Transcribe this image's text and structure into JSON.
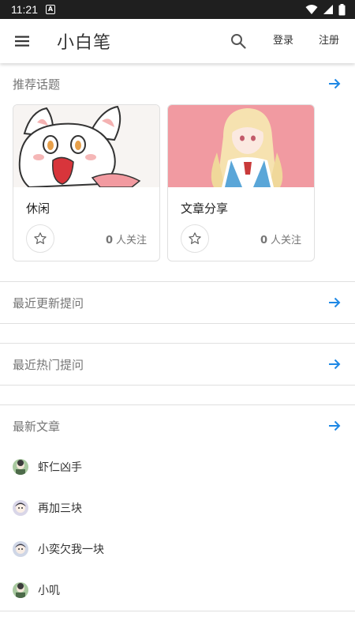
{
  "status_bar": {
    "time": "11:21",
    "notification_letter": "A"
  },
  "app_bar": {
    "title": "小白笔",
    "login_label": "登录",
    "register_label": "注册"
  },
  "recommended": {
    "title": "推荐话题",
    "cards": [
      {
        "title": "休闲",
        "followers": "0",
        "follow_suffix": "人关注"
      },
      {
        "title": "文章分享",
        "followers": "0",
        "follow_suffix": "人关注"
      }
    ]
  },
  "recent_updated": {
    "title": "最近更新提问"
  },
  "recent_hot": {
    "title": "最近热门提问"
  },
  "latest_articles": {
    "title": "最新文章",
    "items": [
      {
        "name": "虾仁凶手"
      },
      {
        "name": "再加三块"
      },
      {
        "name": "小奕欠我一块"
      },
      {
        "name": "小叽"
      }
    ]
  },
  "colors": {
    "accent": "#1e88e5",
    "text_secondary": "#757575",
    "divider": "#e0e0e0"
  }
}
